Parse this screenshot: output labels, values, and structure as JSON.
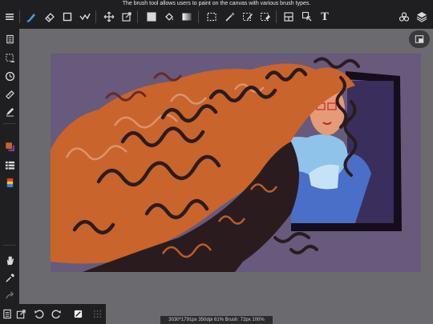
{
  "tooltip": "The brush tool allows users to paint on the canvas with various brush types.",
  "toolbar": {
    "left": [
      {
        "name": "menu-icon",
        "glyph": "≡"
      },
      {
        "name": "brush-tool-icon"
      },
      {
        "name": "eraser-icon"
      },
      {
        "name": "shape-tool-icon"
      },
      {
        "name": "stroke-smoothing-icon"
      },
      {
        "name": "move-tool-icon"
      },
      {
        "name": "transform-tool-icon"
      },
      {
        "name": "fill-color-icon"
      },
      {
        "name": "paint-bucket-icon"
      },
      {
        "name": "gradient-icon"
      },
      {
        "name": "selection-rect-icon"
      },
      {
        "name": "magic-wand-icon"
      },
      {
        "name": "selection-pen-icon"
      },
      {
        "name": "selection-eraser-icon"
      },
      {
        "name": "frame-divider-icon"
      },
      {
        "name": "cursor-select-icon"
      },
      {
        "name": "text-tool-icon",
        "glyph": "T"
      }
    ],
    "right": [
      {
        "name": "materials-icon"
      },
      {
        "name": "layers-icon"
      }
    ]
  },
  "active_tool_color": "#3fa0e0",
  "status": "3030*1791px 350dpi 61% Brush: 72px 100%",
  "colors": {
    "chrome": "#1f1f21",
    "workspace": "#6b6b6f",
    "canvas_bg": "#675a7c",
    "hair_orange": "#c9642c",
    "hair_dark": "#2a1c1e",
    "hair_light": "#e0a07a",
    "frame": "#150d1a",
    "sweater_light": "#8fc3ea",
    "sweater_blue": "#4a6fc8"
  }
}
